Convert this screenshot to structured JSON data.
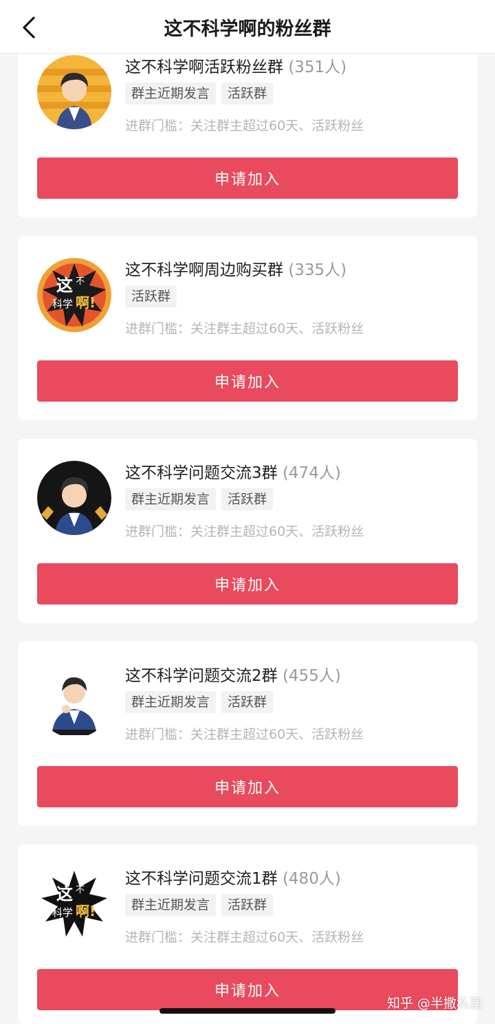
{
  "header": {
    "title": "这不科学啊的粉丝群",
    "back_icon": "chevron-left-icon"
  },
  "colors": {
    "accent": "#ea4a5d",
    "muted_text": "#9a9a9a",
    "tag_bg": "#f2f2f2"
  },
  "groups": [
    {
      "name": "这不科学啊活跃粉丝群",
      "count": "(351人)",
      "tags": [
        "群主近期发言",
        "活跃群"
      ],
      "requirement": "进群门槛：关注群主超过60天、活跃粉丝",
      "button_label": "申请加入",
      "avatar_icon": "cartoon-boy-avatar-icon"
    },
    {
      "name": "这不科学啊周边购买群",
      "count": "(335人)",
      "tags": [
        "活跃群"
      ],
      "requirement": "进群门槛：关注群主超过60天、活跃粉丝",
      "button_label": "申请加入",
      "avatar_icon": "brand-logo-avatar-icon"
    },
    {
      "name": "这不科学问题交流3群",
      "count": "(474人)",
      "tags": [
        "群主近期发言",
        "活跃群"
      ],
      "requirement": "进群门槛：关注群主超过60天、活跃粉丝",
      "button_label": "申请加入",
      "avatar_icon": "cartoon-boy-avatar-icon"
    },
    {
      "name": "这不科学问题交流2群",
      "count": "(455人)",
      "tags": [
        "群主近期发言",
        "活跃群"
      ],
      "requirement": "进群门槛：关注群主超过60天、活跃粉丝",
      "button_label": "申请加入",
      "avatar_icon": "cartoon-boy-avatar-icon"
    },
    {
      "name": "这不科学问题交流1群",
      "count": "(480人)",
      "tags": [
        "群主近期发言",
        "活跃群"
      ],
      "requirement": "进群门槛：关注群主超过60天、活跃粉丝",
      "button_label": "申请加入",
      "avatar_icon": "brand-logo-avatar-icon"
    }
  ],
  "avatar_logo_text": {
    "line1": "这",
    "line2": "不",
    "line3": "科学",
    "line4": "啊!"
  },
  "watermark": "知乎 @半撒私塾"
}
